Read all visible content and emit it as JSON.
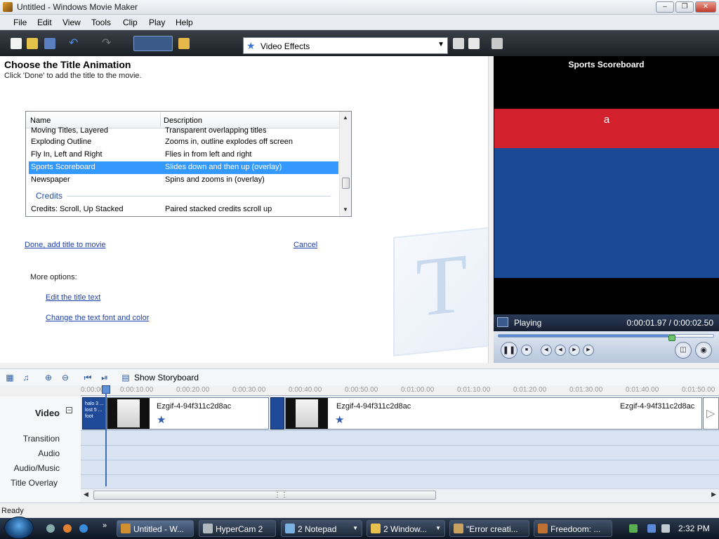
{
  "window": {
    "title": "Untitled - Windows Movie Maker"
  },
  "menu": [
    "File",
    "Edit",
    "View",
    "Tools",
    "Clip",
    "Play",
    "Help"
  ],
  "toolbar": {
    "effects_select": "Video Effects"
  },
  "task_pane": {
    "heading": "Choose the Title Animation",
    "subhead": "Click 'Done' to add the title to the movie.",
    "list": {
      "columns": [
        "Name",
        "Description"
      ],
      "rows": [
        {
          "name": "Moving Titles, Layered",
          "desc": "Transparent overlapping titles"
        },
        {
          "name": "Exploding Outline",
          "desc": "Zooms in, outline explodes off screen"
        },
        {
          "name": "Fly In, Left and Right",
          "desc": "Flies in from left and right"
        },
        {
          "name": "Sports Scoreboard",
          "desc": "Slides down and then up (overlay)"
        },
        {
          "name": "Newspaper",
          "desc": "Spins and zooms in (overlay)"
        }
      ],
      "group": "Credits",
      "group_rows": [
        {
          "name": "Credits: Scroll, Up Stacked",
          "desc": "Paired stacked credits scroll up"
        }
      ]
    },
    "done_link": "Done, add title to movie",
    "cancel_link": "Cancel",
    "more_options": "More options:",
    "edit_text_link": "Edit the title text",
    "font_color_link": "Change the text font and color"
  },
  "preview": {
    "title": "Sports Scoreboard",
    "overlay_text": "a",
    "status": "Playing",
    "time": "0:00:01.97 / 0:00:02.50",
    "progress": 0.79
  },
  "timeline": {
    "storyboard_label": "Show Storyboard",
    "ruler": [
      "0:00:00",
      "0:00:10.00",
      "0:00:20.00",
      "0:00:30.00",
      "0:00:40.00",
      "0:00:50.00",
      "0:01:00.00",
      "0:01:10.00",
      "0:01:20.00",
      "0:01:30.00",
      "0:01:40.00",
      "0:01:50.00"
    ],
    "tracks": [
      "Video",
      "Transition",
      "Audio",
      "Audio/Music",
      "Title Overlay"
    ],
    "title_clip_text": "halo 3 ... lost 5 ... foot",
    "clips": [
      "Ezgif-4-94f311c2d8ac",
      "Ezgif-4-94f311c2d8ac",
      "Ezgif-4-94f311c2d8ac"
    ]
  },
  "status_bar": "Ready",
  "taskbar": {
    "items": [
      "Untitled - W...",
      "HyperCam 2",
      "2 Notepad",
      "2 Window...",
      "\"Error creati...",
      "Freedoom: ..."
    ],
    "clock": "2:32 PM"
  }
}
